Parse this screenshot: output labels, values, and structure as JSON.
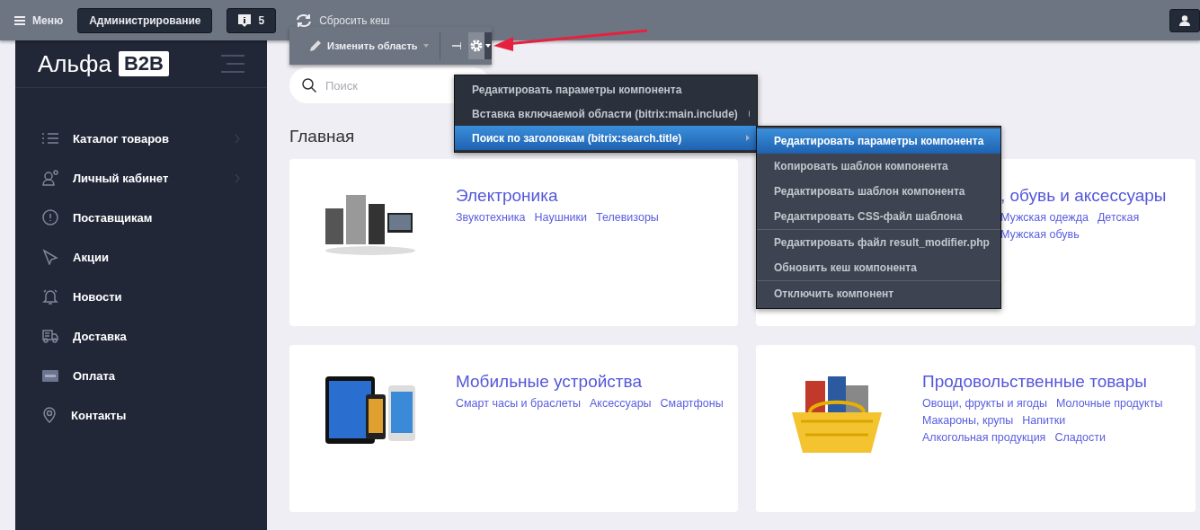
{
  "topbar": {
    "menu_label": "Меню",
    "admin_button": "Администрирование",
    "notifications_count": "5",
    "reset_cache": "Сбросить кеш"
  },
  "edit_toolbar": {
    "change_area": "Изменить область"
  },
  "logo": {
    "text": "Альфа",
    "badge": "B2B"
  },
  "sidebar": {
    "items": [
      {
        "label": "Каталог товаров",
        "expandable": true
      },
      {
        "label": "Личный кабинет",
        "expandable": true
      },
      {
        "label": "Поставщикам",
        "expandable": false
      },
      {
        "label": "Акции",
        "expandable": false
      },
      {
        "label": "Новости",
        "expandable": false
      },
      {
        "label": "Доставка",
        "expandable": false
      },
      {
        "label": "Оплата",
        "expandable": false
      },
      {
        "label": "Контакты",
        "expandable": false
      }
    ]
  },
  "search": {
    "placeholder": "Поиск"
  },
  "heading": "Главная",
  "categories": [
    {
      "title": "Электроника",
      "links": [
        "Звукотехника",
        "Наушники",
        "Телевизоры"
      ],
      "kind": "picture"
    },
    {
      "title": ", обувь и аксессуары",
      "links": [
        "Мужская одежда",
        "Детская",
        "Мужская обувь"
      ],
      "kind": "covered"
    },
    {
      "title": "Мобильные устройства",
      "links": [
        "Смарт часы и браслеты",
        "Аксессуары",
        "Смартфоны"
      ],
      "kind": "picture"
    },
    {
      "title": "Продовольственные товары",
      "links": [
        "Овощи, фрукты и ягоды",
        "Молочные продукты",
        "Макароны, крупы",
        "Напитки",
        "Алкогольная продукция",
        "Сладости"
      ],
      "kind": "picture"
    }
  ],
  "context_menu": {
    "items": [
      {
        "label": "Редактировать параметры компонента",
        "submenu": false,
        "selected": false
      },
      {
        "label": "Вставка включаемой области (bitrix:main.include)",
        "submenu": true,
        "selected": false
      },
      {
        "label": "Поиск по заголовкам (bitrix:search.title)",
        "submenu": true,
        "selected": true
      }
    ]
  },
  "submenu": {
    "items": [
      {
        "label": "Редактировать параметры компонента",
        "selected": true,
        "divider_before": false
      },
      {
        "label": "Копировать шаблон компонента",
        "selected": false,
        "divider_before": false
      },
      {
        "label": "Редактировать шаблон компонента",
        "selected": false,
        "divider_before": false
      },
      {
        "label": "Редактировать CSS-файл шаблона",
        "selected": false,
        "divider_before": false
      },
      {
        "label": "Редактировать файл result_modifier.php",
        "selected": false,
        "divider_before": true
      },
      {
        "label": "Обновить кеш компонента",
        "selected": false,
        "divider_before": false
      },
      {
        "label": "Отключить компонент",
        "selected": false,
        "divider_before": true
      }
    ]
  }
}
